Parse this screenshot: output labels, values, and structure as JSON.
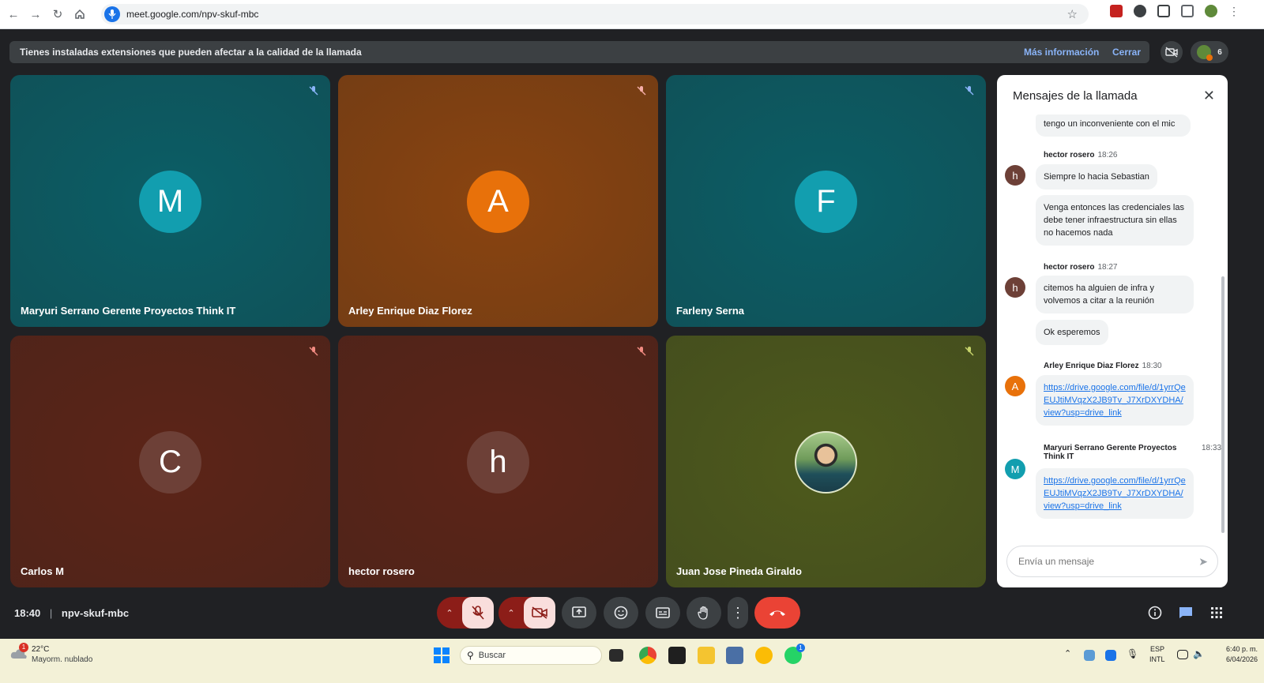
{
  "browser": {
    "url": "meet.google.com/npv-skuf-mbc"
  },
  "banner": {
    "text": "Tienes instaladas extensiones que pueden afectar a la calidad de la llamada",
    "more_info": "Más información",
    "close": "Cerrar",
    "participants_count": "6"
  },
  "tiles": [
    {
      "name": "Maryuri Serrano Gerente Proyectos Think IT",
      "initial": "M",
      "bg": "#0b5e66",
      "avatar_color": "#129eaf"
    },
    {
      "name": "Arley Enrique Diaz Florez",
      "initial": "A",
      "bg": "#8a4410",
      "avatar_color": "#e8710a"
    },
    {
      "name": "Farleny Serna",
      "initial": "F",
      "bg": "#0b5e66",
      "avatar_color": "#129eaf"
    },
    {
      "name": "Carlos M",
      "initial": "C",
      "bg": "#5c2417",
      "avatar_color": "#6d4037"
    },
    {
      "name": "hector rosero",
      "initial": "h",
      "bg": "#5c2417",
      "avatar_color": "#6d4037"
    },
    {
      "name": "Juan Jose Pineda Giraldo",
      "initial": "",
      "bg": "#4e5a1c",
      "avatar_color": "#ffffff"
    }
  ],
  "chat": {
    "title": "Mensajes de la llamada",
    "messages": {
      "m0": "tengo un inconveniente con el mic",
      "s1_name": "hector rosero",
      "s1_time": "18:26",
      "s1_initial": "h",
      "m1": "Siempre lo hacia Sebastian",
      "m2": "Venga entonces las credenciales las debe tener infraestructura sin ellas no hacemos nada",
      "s2_name": "hector rosero",
      "s2_time": "18:27",
      "s2_initial": "h",
      "m3": "citemos ha alguien de infra y volvemos a citar a la reunión",
      "m4": "Ok esperemos",
      "s3_name": "Arley Enrique Diaz Florez",
      "s3_time": "18:30",
      "s3_initial": "A",
      "m5": "https://drive.google.com/file/d/1yrrQeEUJtiMVqzX2JB9Tv_J7XrDXYDHA/view?usp=drive_link",
      "s4_name": "Maryuri Serrano Gerente Proyectos Think IT",
      "s4_time": "18:33",
      "s4_initial": "M",
      "m6": "https://drive.google.com/file/d/1yrrQeEUJtiMVqzX2JB9Tv_J7XrDXYDHA/view?usp=drive_link"
    },
    "input_placeholder": "Envía un mensaje"
  },
  "meeting": {
    "time": "18:40",
    "code": "npv-skuf-mbc"
  },
  "taskbar": {
    "weather_temp": "22°C",
    "weather_desc": "Mayorm. nublado",
    "weather_badge": "1",
    "search_placeholder": "Buscar",
    "lang_1": "ESP",
    "lang_2": "INTL",
    "clock_time": "6:40 p. m.",
    "clock_date": "6/04/2026",
    "whatsapp_badge": "1"
  },
  "colors": {
    "accent": "#8ab4f8",
    "end_call": "#ea4335",
    "muted_off": "#8c1d18"
  }
}
